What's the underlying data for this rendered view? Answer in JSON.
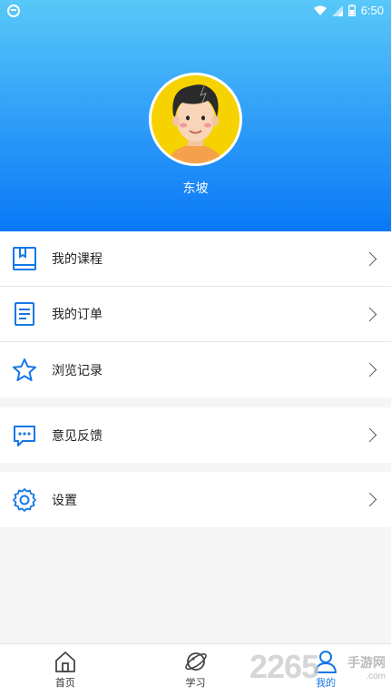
{
  "status_bar": {
    "time": "6:50"
  },
  "profile": {
    "name": "东坡"
  },
  "menu_group_1": [
    {
      "label": "我的课程",
      "icon": "book-icon"
    },
    {
      "label": "我的订单",
      "icon": "document-icon"
    },
    {
      "label": "浏览记录",
      "icon": "star-icon"
    }
  ],
  "menu_group_2": [
    {
      "label": "意见反馈",
      "icon": "chat-bubble-icon"
    }
  ],
  "menu_group_3": [
    {
      "label": "设置",
      "icon": "gear-icon"
    }
  ],
  "tabbar": {
    "tabs": [
      {
        "label": "首页",
        "icon": "home-icon",
        "active": false
      },
      {
        "label": "学习",
        "icon": "planet-icon",
        "active": false
      },
      {
        "label": "我的",
        "icon": "user-icon",
        "active": true
      }
    ]
  },
  "watermark": {
    "number": "2265",
    "text": "手游网",
    "url": ".com"
  },
  "colors": {
    "accent": "#1477e6",
    "header_top": "#58c8f8",
    "header_bottom": "#0a78f6"
  }
}
